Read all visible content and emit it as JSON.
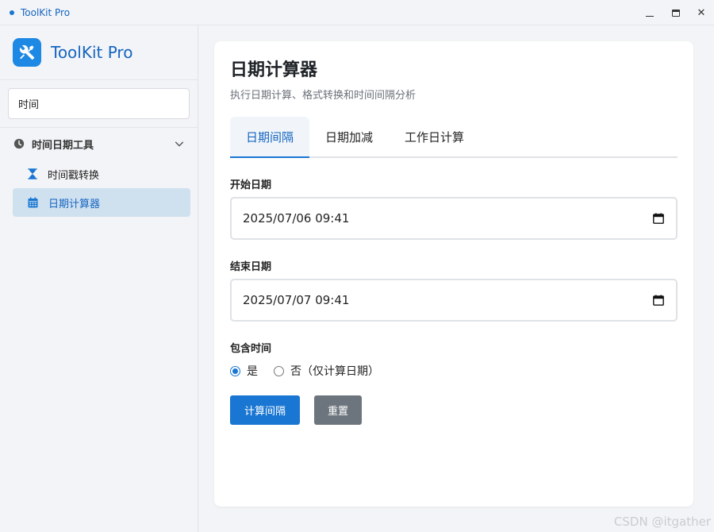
{
  "window": {
    "title": "ToolKit Pro",
    "controls": {
      "minimize_icon": "minimize-icon",
      "maximize_icon": "maximize-icon",
      "close_icon": "close-icon"
    }
  },
  "sidebar": {
    "brand": {
      "name": "ToolKit Pro",
      "icon": "tools-icon"
    },
    "search": {
      "value": "时间",
      "placeholder": ""
    },
    "group": {
      "label": "时间日期工具",
      "icon": "clock-icon",
      "expanded": true
    },
    "items": [
      {
        "label": "时间戳转换",
        "icon": "hourglass-icon",
        "active": false
      },
      {
        "label": "日期计算器",
        "icon": "calendar-icon",
        "active": true
      }
    ]
  },
  "main": {
    "title": "日期计算器",
    "subtitle": "执行日期计算、格式转换和时间间隔分析",
    "tabs": [
      {
        "label": "日期间隔",
        "active": true
      },
      {
        "label": "日期加减",
        "active": false
      },
      {
        "label": "工作日计算",
        "active": false
      }
    ],
    "start": {
      "label": "开始日期",
      "value": "2025/07/06  09:41"
    },
    "end": {
      "label": "结束日期",
      "value": "2025/07/07  09:41"
    },
    "include_time": {
      "label": "包含时间",
      "options": [
        {
          "label": "是",
          "checked": true
        },
        {
          "label": "否（仅计算日期）",
          "checked": false
        }
      ]
    },
    "buttons": {
      "calculate": "计算间隔",
      "reset": "重置"
    }
  },
  "watermark": "CSDN @itgather",
  "colors": {
    "accent": "#1976d2",
    "active_bg": "#cfe0ef",
    "secondary": "#6c757d"
  }
}
